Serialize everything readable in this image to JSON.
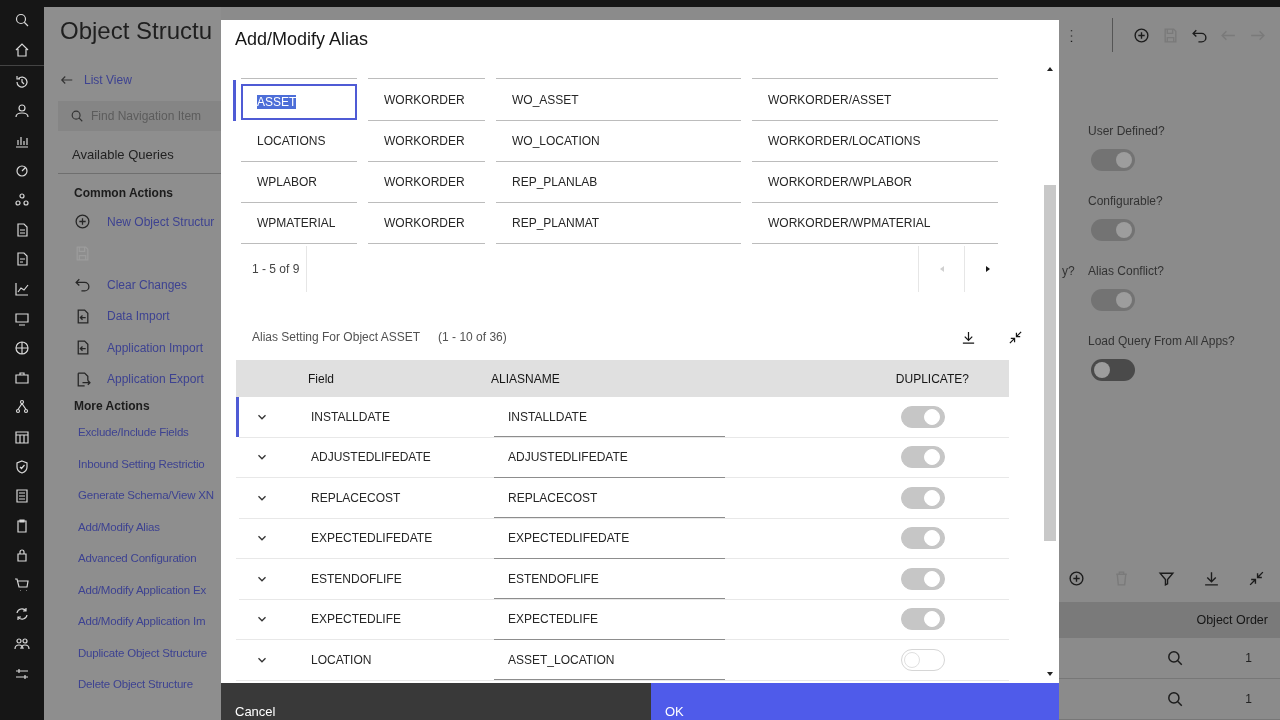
{
  "page_title": "Object Structu",
  "nav": {
    "back_link": "List View",
    "search": {
      "placeholder": "Find Navigation Item"
    },
    "queries": "Available Queries",
    "common_heading": "Common Actions",
    "common_actions": [
      {
        "label": "New Object Structur",
        "disabled": false
      },
      {
        "disabled": true
      },
      {
        "label": "Clear Changes",
        "disabled": false
      },
      {
        "label": "Data Import",
        "disabled": false
      },
      {
        "label": "Application Import",
        "disabled": false
      },
      {
        "label": "Application Export",
        "disabled": false
      }
    ],
    "more_heading": "More Actions",
    "more_actions": [
      "Exclude/Include Fields",
      "Inbound Setting Restrictio",
      "Generate Schema/View XN",
      "Add/Modify Alias",
      "Advanced Configuration",
      "Add/Modify Application Ex",
      "Add/Modify Application Im",
      "Duplicate Object Structure",
      "Delete Object Structure"
    ]
  },
  "right_panel": {
    "cut_label": "y?",
    "toggles": [
      {
        "label": "User Defined?",
        "on": true
      },
      {
        "label": "Configurable?",
        "on": true
      },
      {
        "label": "Alias Conflict?",
        "on": true
      },
      {
        "label": "Load Query From All Apps?",
        "on": false
      }
    ],
    "table": {
      "column": "Object Order",
      "rows": [
        "1",
        "1"
      ]
    }
  },
  "dialog": {
    "title": "Add/Modify Alias",
    "objects": {
      "rows": [
        {
          "cells": [
            "ASSET",
            "WORKORDER",
            "WO_ASSET",
            "WORKORDER/ASSET"
          ],
          "selected": true
        },
        {
          "cells": [
            "LOCATIONS",
            "WORKORDER",
            "WO_LOCATION",
            "WORKORDER/LOCATIONS"
          ],
          "selected": false
        },
        {
          "cells": [
            "WPLABOR",
            "WORKORDER",
            "REP_PLANLAB",
            "WORKORDER/WPLABOR"
          ],
          "selected": false
        },
        {
          "cells": [
            "WPMATERIAL",
            "WORKORDER",
            "REP_PLANMAT",
            "WORKORDER/WPMATERIAL"
          ],
          "selected": false
        }
      ],
      "pagination": "1 - 5 of 9"
    },
    "alias_section": {
      "title": "Alias Setting For Object ASSET",
      "range": "(1 - 10 of 36)",
      "columns": [
        "Field",
        "ALIASNAME",
        "DUPLICATE?"
      ],
      "rows": [
        {
          "field": "INSTALLDATE",
          "alias": "INSTALLDATE",
          "duplicate": true,
          "selected": true
        },
        {
          "field": "ADJUSTEDLIFEDATE",
          "alias": "ADJUSTEDLIFEDATE",
          "duplicate": true,
          "selected": false
        },
        {
          "field": "REPLACECOST",
          "alias": "REPLACECOST",
          "duplicate": true,
          "selected": false
        },
        {
          "field": "EXPECTEDLIFEDATE",
          "alias": "EXPECTEDLIFEDATE",
          "duplicate": true,
          "selected": false
        },
        {
          "field": "ESTENDOFLIFE",
          "alias": "ESTENDOFLIFE",
          "duplicate": true,
          "selected": false
        },
        {
          "field": "EXPECTEDLIFE",
          "alias": "EXPECTEDLIFE",
          "duplicate": true,
          "selected": false
        },
        {
          "field": "LOCATION",
          "alias": "ASSET_LOCATION",
          "duplicate": false,
          "selected": false
        }
      ]
    },
    "buttons": {
      "cancel": "Cancel",
      "ok": "OK"
    }
  }
}
